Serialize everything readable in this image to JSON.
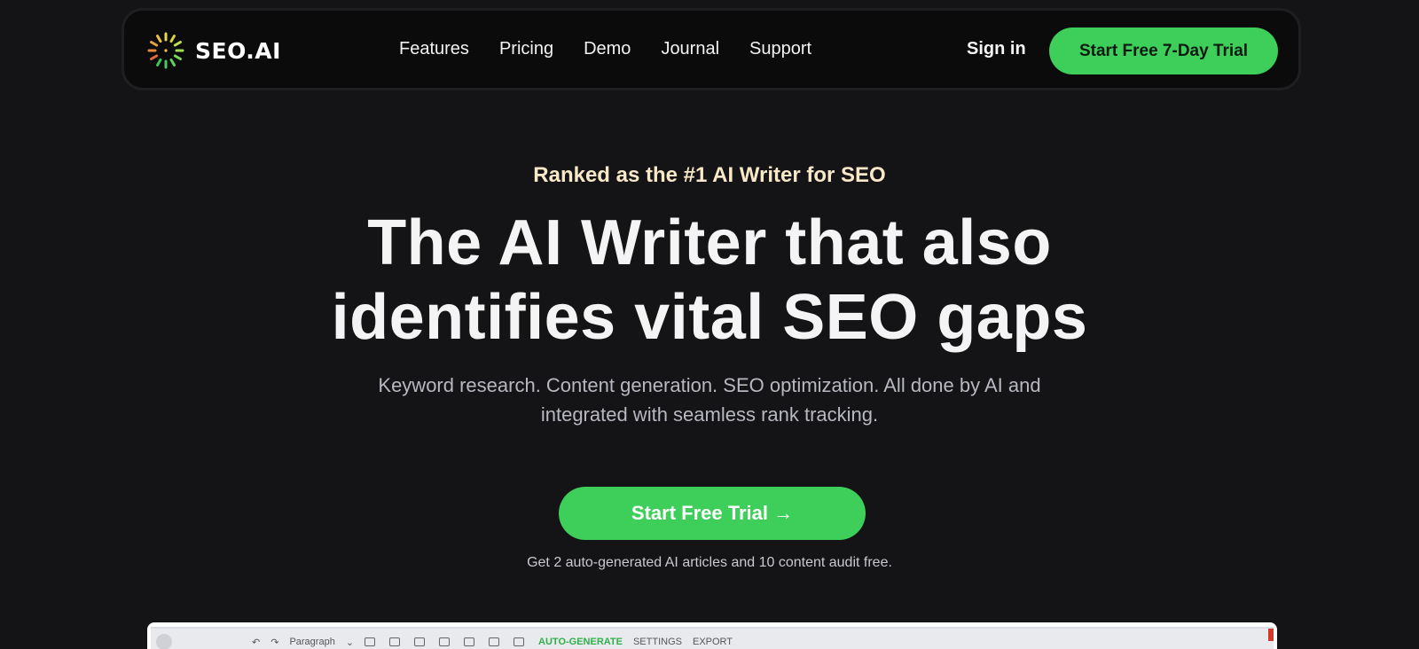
{
  "nav": {
    "logo_text": "SEO.AI",
    "links": [
      "Features",
      "Pricing",
      "Demo",
      "Journal",
      "Support"
    ],
    "sign_in": "Sign in",
    "trial_button": "Start Free 7-Day Trial"
  },
  "hero": {
    "eyebrow": "Ranked as the #1 AI Writer for SEO",
    "headline_line1": "The AI Writer that also",
    "headline_line2": "identifies vital SEO gaps",
    "subhead": "Keyword research. Content generation. SEO optimization. All done by AI and integrated with seamless rank tracking.",
    "cta": "Start Free Trial →",
    "note": "Get 2 auto-generated AI articles and 10 content audit free."
  },
  "preview": {
    "toolbar": {
      "paragraph": "Paragraph",
      "auto_generate": "AUTO-GENERATE",
      "settings": "SETTINGS",
      "export": "EXPORT"
    }
  },
  "colors": {
    "background": "#141416",
    "accent_green": "#3ecf5a",
    "eyebrow": "#f8e8c8"
  },
  "icons": {
    "logo": "burst-logo-icon",
    "cta_arrow": "arrow-right"
  }
}
